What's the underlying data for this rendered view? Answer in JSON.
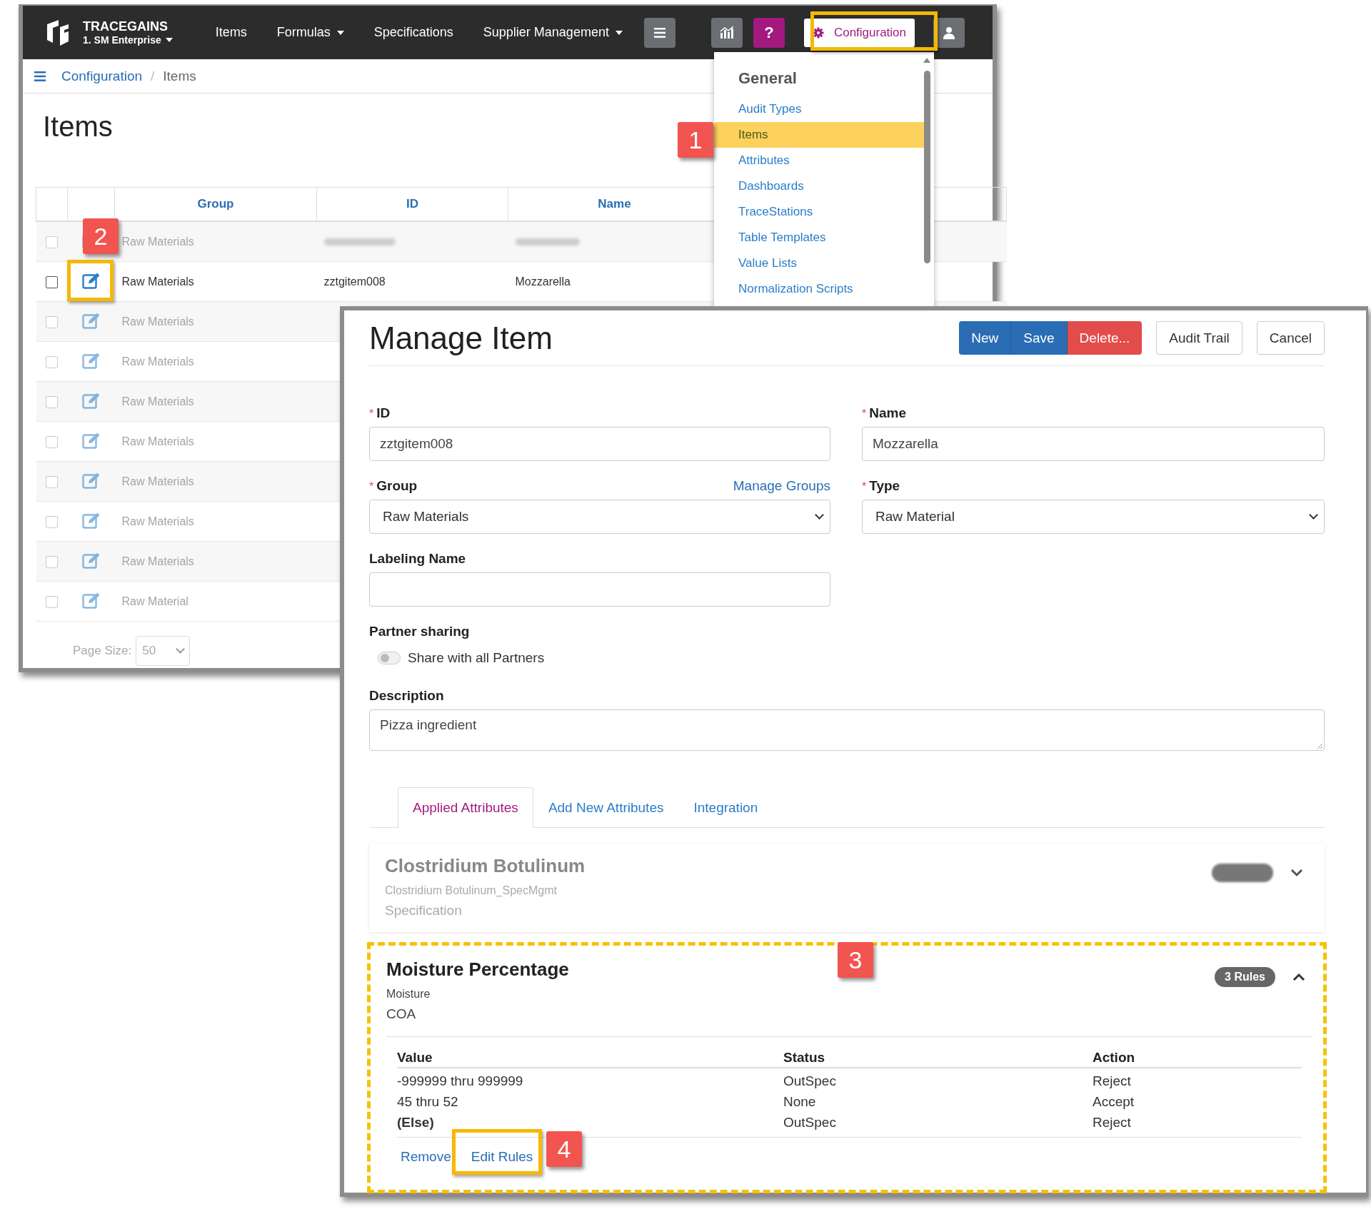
{
  "nav": {
    "brand": "TRACEGAINS",
    "org": "1. SM Enterprise",
    "links": [
      {
        "label": "Items",
        "dropdown": false
      },
      {
        "label": "Formulas",
        "dropdown": true
      },
      {
        "label": "Specifications",
        "dropdown": false
      },
      {
        "label": "Supplier Management",
        "dropdown": true
      }
    ],
    "help_label": "?",
    "config_label": "Configuration"
  },
  "breadcrumb": [
    {
      "label": "Configuration",
      "link": true
    },
    {
      "label": "Items",
      "link": false
    }
  ],
  "breadcrumb_separator": "/",
  "required_mark": "*",
  "page_title": "Items",
  "table": {
    "columns": [
      "Group",
      "ID",
      "Name"
    ],
    "rows": [
      {
        "checked": false,
        "blurred": true,
        "group": "Raw Materials",
        "values_blurred": true
      },
      {
        "checked": false,
        "blurred": false,
        "group": "Raw Materials",
        "id": "zztgitem008",
        "name": "Mozzarella"
      },
      {
        "checked": false,
        "blurred": true,
        "group": "Raw Materials"
      },
      {
        "checked": false,
        "blurred": true,
        "group": "Raw Materials"
      },
      {
        "checked": false,
        "blurred": true,
        "group": "Raw Materials"
      },
      {
        "checked": false,
        "blurred": true,
        "group": "Raw Materials"
      },
      {
        "checked": false,
        "blurred": true,
        "group": "Raw Materials"
      },
      {
        "checked": false,
        "blurred": true,
        "group": "Raw Materials"
      },
      {
        "checked": false,
        "blurred": true,
        "group": "Raw Materials"
      },
      {
        "checked": false,
        "blurred": true,
        "group": "Raw Material"
      }
    ],
    "page_size_label": "Page Size:",
    "page_size": "50"
  },
  "dropdown": {
    "heading": "General",
    "items": [
      {
        "label": "Audit Types",
        "selected": false
      },
      {
        "label": "Items",
        "selected": true
      },
      {
        "label": "Attributes",
        "selected": false
      },
      {
        "label": "Dashboards",
        "selected": false
      },
      {
        "label": "TraceStations",
        "selected": false
      },
      {
        "label": "Table Templates",
        "selected": false
      },
      {
        "label": "Value Lists",
        "selected": false
      },
      {
        "label": "Normalization Scripts",
        "selected": false
      }
    ]
  },
  "manage_item": {
    "title": "Manage Item",
    "buttons": [
      {
        "label": "New",
        "kind": "primary"
      },
      {
        "label": "Save",
        "kind": "primary"
      },
      {
        "label": "Delete...",
        "kind": "danger"
      },
      {
        "label": "Audit Trail",
        "kind": "default"
      },
      {
        "label": "Cancel",
        "kind": "default"
      }
    ],
    "id": {
      "label": "ID",
      "required": true,
      "value": "zztgitem008"
    },
    "name": {
      "label": "Name",
      "required": true,
      "value": "Mozzarella"
    },
    "group": {
      "label": "Group",
      "required": true,
      "value": "Raw Materials",
      "link": "Manage Groups"
    },
    "type": {
      "label": "Type",
      "required": true,
      "value": "Raw Material"
    },
    "labeling_name": {
      "label": "Labeling Name",
      "required": false
    },
    "partner_sharing": {
      "label": "Partner sharing",
      "toggle_label": "Share with all Partners",
      "on": false
    },
    "description": {
      "label": "Description",
      "value": "Pizza ingredient"
    },
    "tabs": [
      {
        "label": "Applied Attributes",
        "selected": true
      },
      {
        "label": "Add New Attributes",
        "selected": false
      },
      {
        "label": "Integration",
        "selected": false
      }
    ],
    "attributes": [
      {
        "title": "Clostridium Botulinum",
        "subtitle": "Clostridium Botulinum_SpecMgmt",
        "source": "Specification",
        "blurred": true,
        "expanded": false
      },
      {
        "title": "Moisture Percentage",
        "subtitle": "Moisture",
        "source": "COA",
        "badge": "3 Rules",
        "blurred": false,
        "expanded": true,
        "rule_columns": [
          "Value",
          "Status",
          "Action"
        ],
        "rules": [
          {
            "value": "-999999 thru 999999",
            "status": "OutSpec",
            "action": "Reject",
            "kind": "range"
          },
          {
            "value": "45 thru 52",
            "status": "None",
            "action": "Accept",
            "kind": "range"
          },
          {
            "value": "(Else)",
            "status": "OutSpec",
            "action": "Reject",
            "kind": "else"
          }
        ],
        "actions": [
          "Remove",
          "Edit Rules"
        ]
      }
    ]
  },
  "callouts": [
    "1",
    "2",
    "3",
    "4"
  ]
}
